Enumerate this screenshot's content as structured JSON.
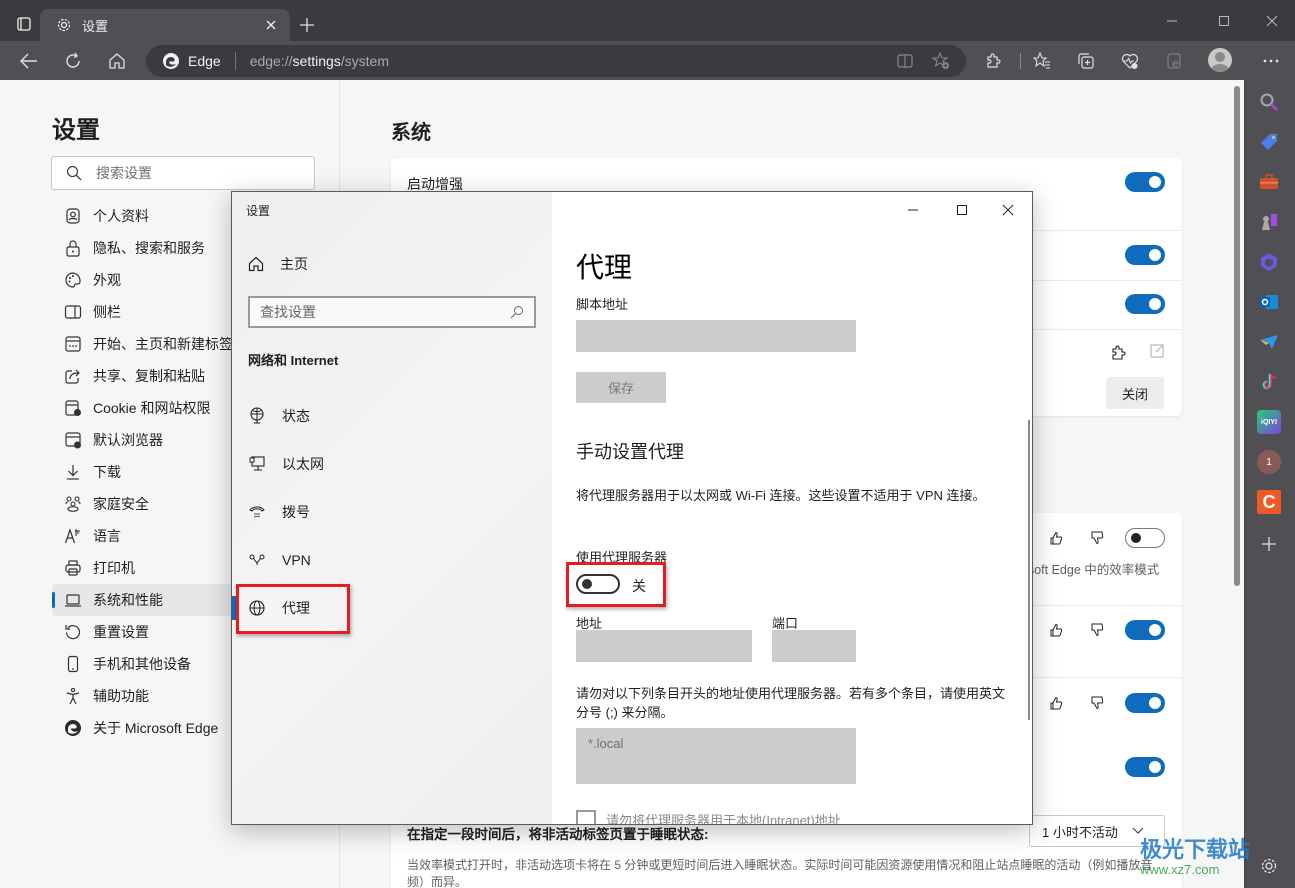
{
  "browser": {
    "tab_title": "设置",
    "address": {
      "site_label": "Edge",
      "url_prefix": "edge://",
      "url_host": "settings",
      "url_path": "/system"
    }
  },
  "settings_nav": {
    "title": "设置",
    "search_placeholder": "搜索设置",
    "items": [
      {
        "label": "个人资料",
        "icon": "profile-icon"
      },
      {
        "label": "隐私、搜索和服务",
        "icon": "lock-icon"
      },
      {
        "label": "外观",
        "icon": "palette-icon"
      },
      {
        "label": "侧栏",
        "icon": "sidebar-icon"
      },
      {
        "label": "开始、主页和新建标签页",
        "icon": "new-tab-icon"
      },
      {
        "label": "共享、复制和粘贴",
        "icon": "share-icon"
      },
      {
        "label": "Cookie 和网站权限",
        "icon": "cookie-icon"
      },
      {
        "label": "默认浏览器",
        "icon": "default-browser-icon"
      },
      {
        "label": "下载",
        "icon": "download-icon"
      },
      {
        "label": "家庭安全",
        "icon": "family-icon"
      },
      {
        "label": "语言",
        "icon": "language-icon"
      },
      {
        "label": "打印机",
        "icon": "printer-icon"
      },
      {
        "label": "系统和性能",
        "icon": "laptop-icon",
        "active": true
      },
      {
        "label": "重置设置",
        "icon": "reset-icon"
      },
      {
        "label": "手机和其他设备",
        "icon": "phone-icon"
      },
      {
        "label": "辅助功能",
        "icon": "accessibility-icon"
      },
      {
        "label": "关于 Microsoft Edge",
        "icon": "edge-logo-icon"
      }
    ]
  },
  "system_page": {
    "title": "系统",
    "startup_boost_label": "启动增强",
    "close_button": "关闭",
    "efficiency_desc_fragment": "osoft Edge 中的效率模式",
    "sleep_label": "在指定一段时间后，将非活动标签页置于睡眠状态:",
    "sleep_value": "1 小时不活动",
    "sleep_desc": "当效率模式打开时，非活动选项卡将在 5 分钟或更短时间后进入睡眠状态。实际时间可能因资源使用情况和阻止站点睡眠的活动（例如播放音频）而异。",
    "toggles": {
      "startup_boost": true,
      "background_apps": true,
      "hardware_acceleration": true,
      "efficiency_mode": false,
      "save_resources_1": true,
      "save_resources_2": true,
      "save_resources_3": true
    }
  },
  "win_settings": {
    "window_title": "设置",
    "home_label": "主页",
    "search_placeholder": "查找设置",
    "section": "网络和 Internet",
    "nav": [
      {
        "label": "状态",
        "icon": "network-status-icon"
      },
      {
        "label": "以太网",
        "icon": "ethernet-icon"
      },
      {
        "label": "拨号",
        "icon": "dialup-icon"
      },
      {
        "label": "VPN",
        "icon": "vpn-icon"
      },
      {
        "label": "代理",
        "icon": "globe-icon",
        "active": true
      }
    ],
    "proxy": {
      "heading": "代理",
      "script_address_label": "脚本地址",
      "script_address_value": "",
      "save_button": "保存",
      "manual_heading": "手动设置代理",
      "manual_desc": "将代理服务器用于以太网或 Wi-Fi 连接。这些设置不适用于 VPN 连接。",
      "use_proxy_label": "使用代理服务器",
      "use_proxy_state": "关",
      "use_proxy_on": false,
      "address_label": "地址",
      "address_value": "",
      "port_label": "端口",
      "port_value": "",
      "exceptions_desc": "请勿对以下列条目开头的地址使用代理服务器。若有多个条目，请使用英文分号 (;) 来分隔。",
      "exceptions_placeholder": "*.local",
      "bypass_local_label": "请勿将代理服务器用于本地(Intranet)地址",
      "bypass_local_checked": false
    }
  },
  "watermark": {
    "text": "极光下载站",
    "url": "www.xz7.com"
  },
  "colors": {
    "accent": "#0f6cbd",
    "highlight_box": "#e51c23"
  }
}
